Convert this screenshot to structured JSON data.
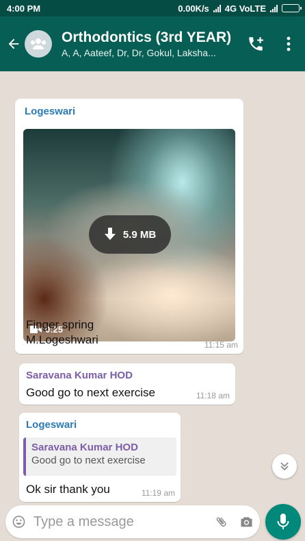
{
  "status_bar": {
    "time": "4:00 PM",
    "speed": "0.00K/s",
    "network": "4G VoLTE"
  },
  "app_bar": {
    "title": "Orthodontics (3rd YEAR)",
    "subtitle": "A, A, Aateef, Dr, Dr, Gokul, Laksha..."
  },
  "colors": {
    "header": "#075e54",
    "statusbar": "#054d44",
    "accent": "#00897b",
    "sender_blue": "#2b7ab8",
    "sender_purple": "#7b5ea7"
  },
  "messages": [
    {
      "sender": "Logeswari",
      "sender_color": "#2b7ab8",
      "video": {
        "size": "5.9 MB",
        "duration": "0:25"
      },
      "text_line1": "Finger spring",
      "text_line2": "M.Logeshwari",
      "time": "11:15 am"
    },
    {
      "sender": "Saravana Kumar HOD",
      "sender_color": "#7b5ea7",
      "text": "Good go to next exercise",
      "time": "11:18 am"
    },
    {
      "sender": "Logeswari",
      "sender_color": "#2b7ab8",
      "quote": {
        "name": "Saravana Kumar HOD",
        "text": "Good go to next exercise"
      },
      "text": "Ok sir thank you",
      "time": "11:19 am"
    }
  ],
  "input": {
    "placeholder": "Type a message"
  },
  "icons": [
    "back-arrow-icon",
    "group-avatar-icon",
    "add-call-icon",
    "more-vert-icon",
    "download-icon",
    "videocam-icon",
    "double-chevron-down-icon",
    "emoji-icon",
    "attach-icon",
    "camera-icon",
    "mic-icon"
  ]
}
